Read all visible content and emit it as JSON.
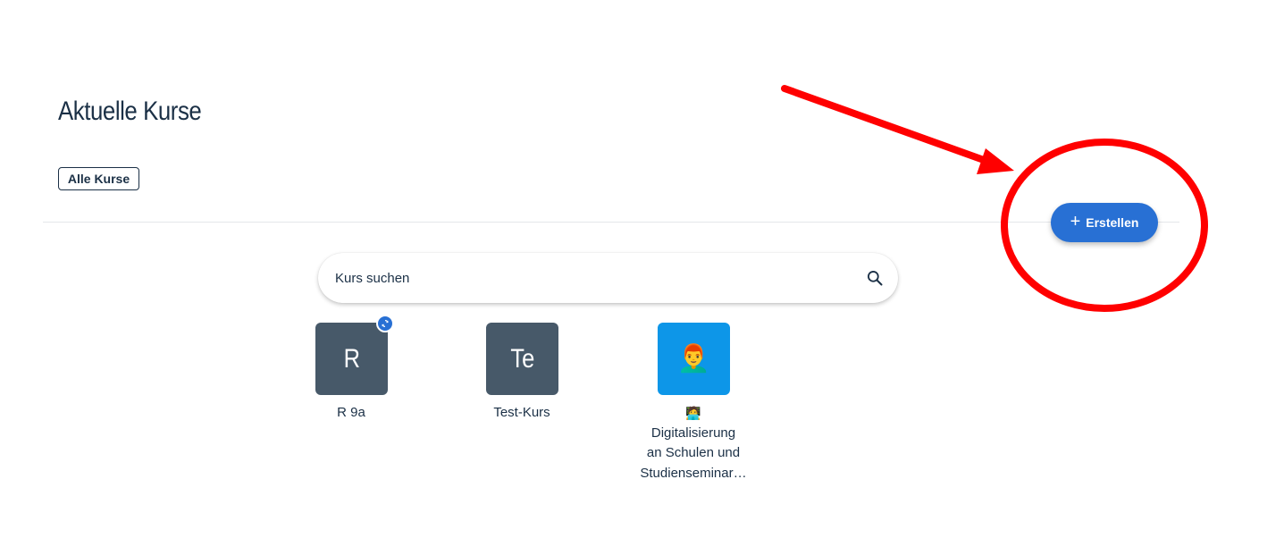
{
  "header": {
    "title": "Aktuelle Kurse",
    "tab_label": "Alle Kurse"
  },
  "fab": {
    "label": "Erstellen",
    "icon": "plus-icon"
  },
  "search": {
    "placeholder": "Kurs suchen",
    "icon": "search-icon"
  },
  "courses": [
    {
      "initials": "R",
      "name": "R 9a",
      "color": "#475969",
      "badge": "sync-icon"
    },
    {
      "initials": "Te",
      "name": "Test-Kurs",
      "color": "#475969"
    },
    {
      "emoji": "👨‍🦰",
      "name_line1": "🧑‍💻",
      "name_line2": "Digitalisierung",
      "name_line3": "an Schulen und",
      "name_line4": "Studienseminar…",
      "color": "#0d96e8"
    }
  ],
  "colors": {
    "accent": "#2870d4",
    "annotation": "#ff0000",
    "text": "#1b3046"
  }
}
